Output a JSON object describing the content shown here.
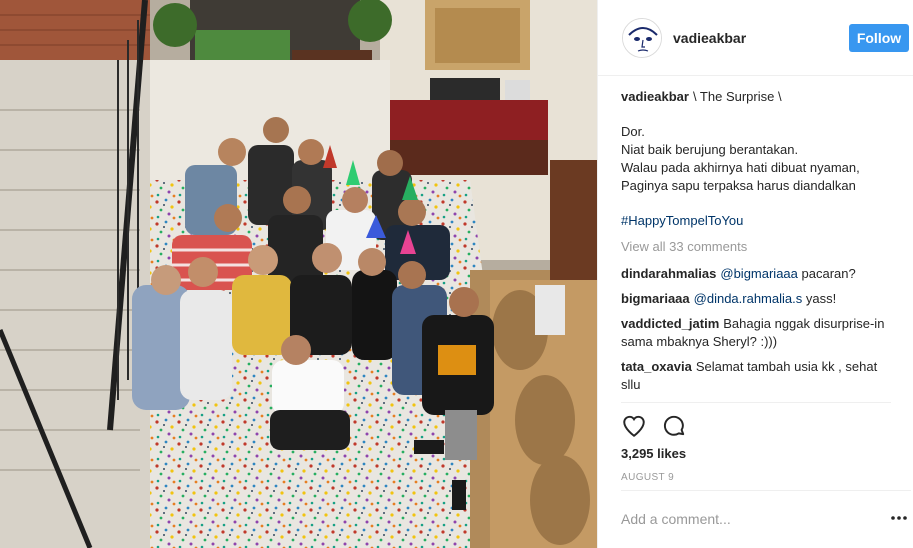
{
  "post": {
    "username": "vadieakbar",
    "follow_label": "Follow",
    "caption": {
      "username": "vadieakbar",
      "title": "\\ The Surprise \\",
      "lines": [
        "Dor.",
        "Niat baik berujung berantakan.",
        "Walau pada akhirnya hati dibuat nyaman,",
        "Paginya sapu terpaksa harus diandalkan"
      ],
      "hashtag": "#HappyTompelToYou"
    },
    "view_all_comments": "View all 33 comments",
    "comments": [
      {
        "username": "dindarahmalias",
        "mention": "@bigmariaaa",
        "text": " pacaran?"
      },
      {
        "username": "bigmariaaa",
        "mention": "@dinda.rahmalia.s",
        "text": " yass!"
      },
      {
        "username": "vaddicted_jatim",
        "mention": "",
        "text": "Bahagia nggak disurprise-in sama mbaknya Sheryl? :)))"
      },
      {
        "username": "tata_oxavia",
        "mention": "",
        "text": "Selamat tambah usia kk , sehat sllu"
      }
    ],
    "likes": "3,295 likes",
    "date": "AUGUST 9",
    "add_comment_placeholder": "Add a comment..."
  },
  "icons": {
    "heart": "heart-icon",
    "comment": "comment-icon",
    "more": "more-options-icon"
  },
  "colors": {
    "follow_button": "#3897f0",
    "link": "#003569",
    "muted": "#999999",
    "border": "#efefef"
  }
}
